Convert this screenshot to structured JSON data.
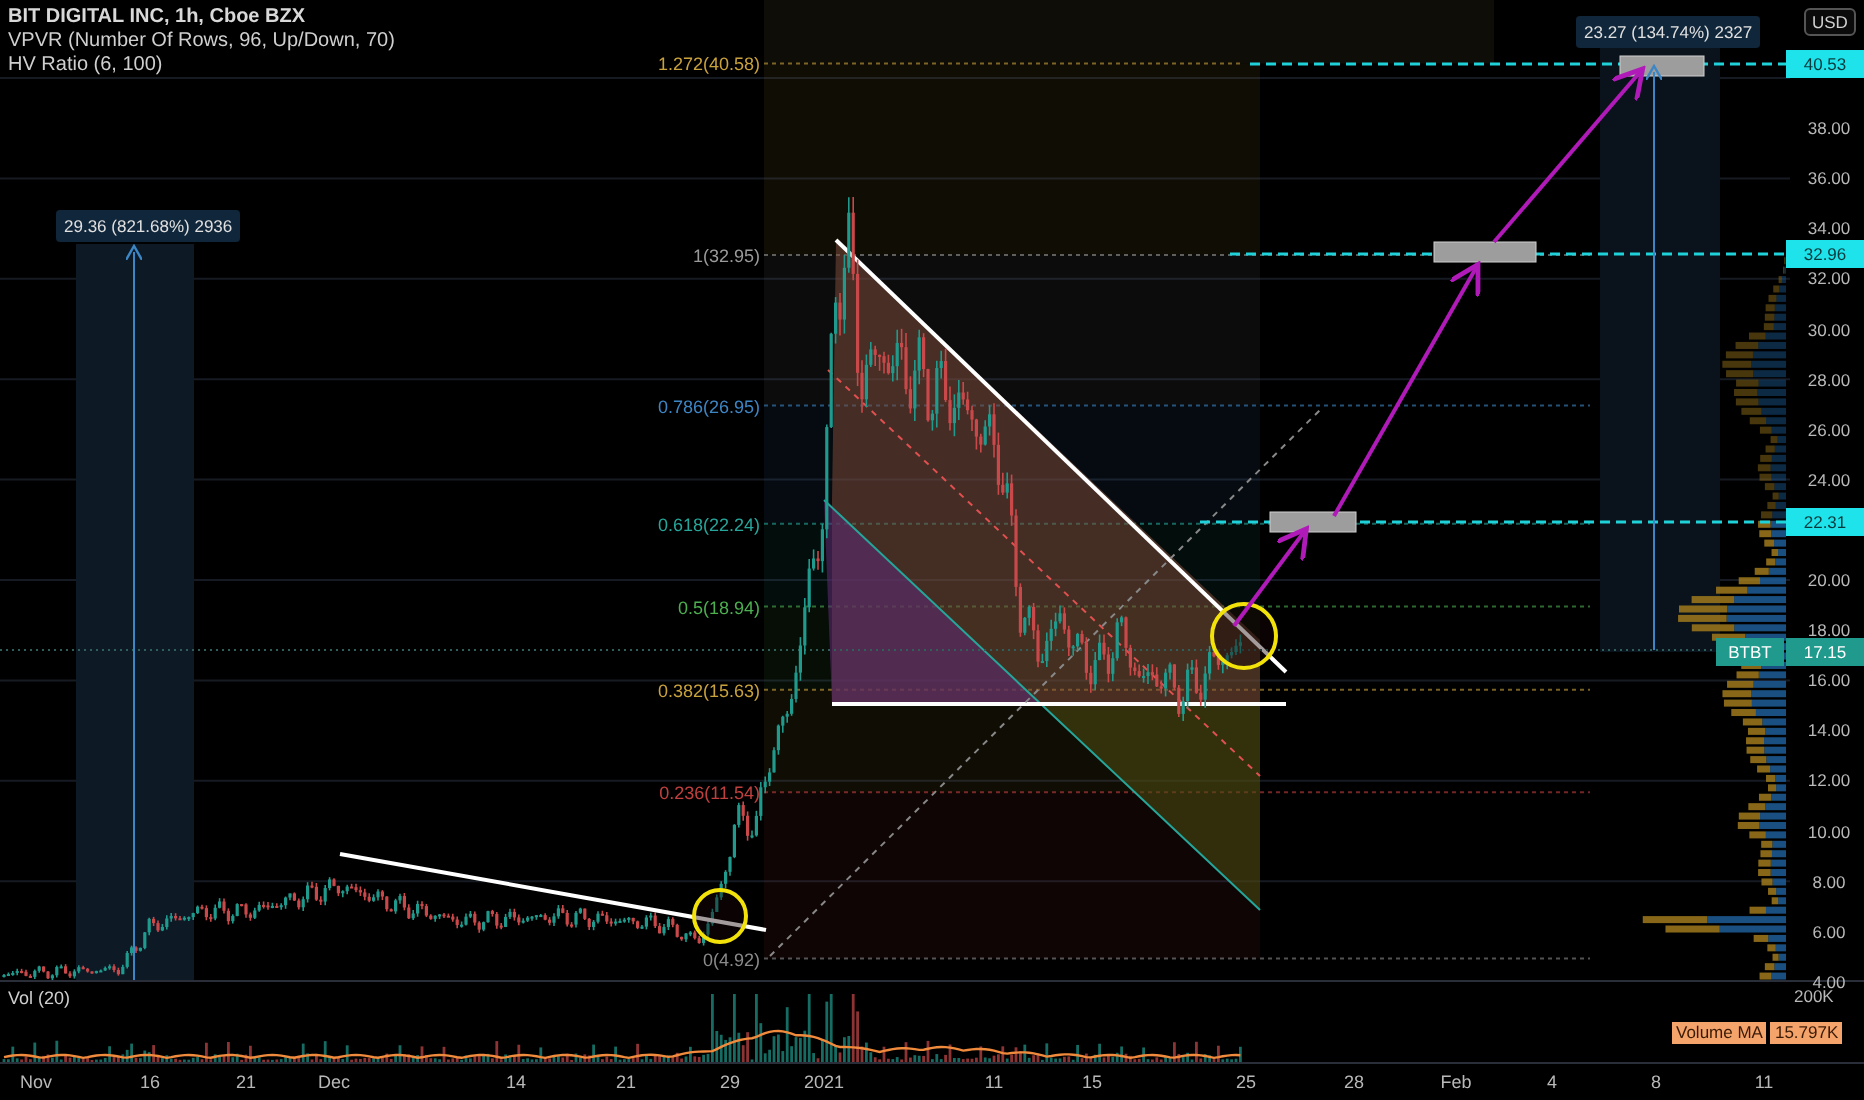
{
  "legend": {
    "title": "BIT DIGITAL INC, 1h, Cboe BZX",
    "indicators": [
      "VPVR (Number Of Rows, 96, Up/Down, 70)",
      "HV Ratio (6, 100)"
    ]
  },
  "fib_levels": [
    {
      "label": "1.272(40.58)",
      "color": "#c9a23c"
    },
    {
      "label": "1(32.95)",
      "color": "#9a9a9a"
    },
    {
      "label": "0.786(26.95)",
      "color": "#3d86c6"
    },
    {
      "label": "0.618(22.24)",
      "color": "#26a69a"
    },
    {
      "label": "0.5(18.94)",
      "color": "#4caf50"
    },
    {
      "label": "0.382(15.63)",
      "color": "#c9a23c"
    },
    {
      "label": "0.236(11.54)",
      "color": "#c0403f"
    },
    {
      "label": "0(4.92)",
      "color": "#8a8a8a"
    }
  ],
  "measurements": [
    {
      "label": "29.36 (821.68%) 2936"
    },
    {
      "label": "23.27 (134.74%) 2327"
    }
  ],
  "price_axis": {
    "currency": "USD",
    "ticks": [
      "38.00",
      "36.00",
      "34.00",
      "32.00",
      "30.00",
      "28.00",
      "26.00",
      "24.00",
      "20.00",
      "18.00",
      "16.00",
      "14.00",
      "12.00",
      "10.00",
      "8.00",
      "6.00",
      "4.00"
    ],
    "labels": [
      {
        "kind": "target",
        "text": "40.53"
      },
      {
        "kind": "target",
        "text": "32.96"
      },
      {
        "kind": "target",
        "text": "22.31"
      },
      {
        "kind": "symbol",
        "text": "BTBT"
      },
      {
        "kind": "last",
        "text": "17.15"
      }
    ]
  },
  "volume_pane": {
    "title": "Vol (20)",
    "scale": "200K",
    "ma_label": "Volume MA",
    "ma_value": "15.797K"
  },
  "time_axis": [
    "Nov",
    "16",
    "21",
    "Dec",
    "14",
    "21",
    "29",
    "2021",
    "11",
    "15",
    "25",
    "28",
    "Feb",
    "4",
    "8",
    "11"
  ]
}
